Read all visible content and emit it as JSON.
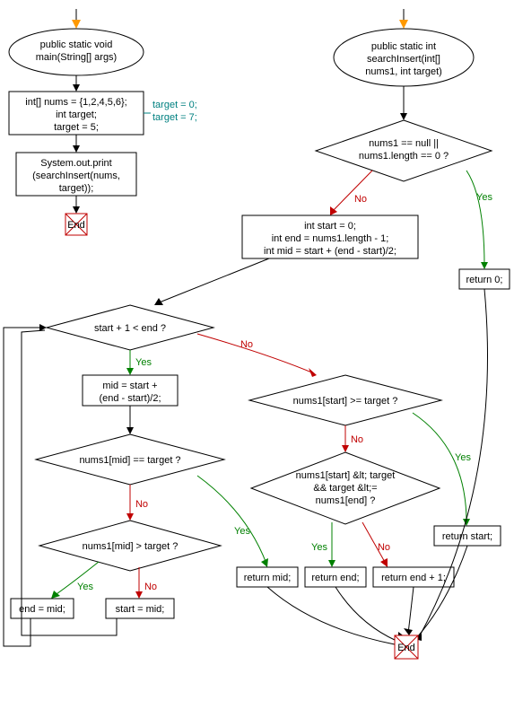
{
  "chart_data": {
    "type": "flowchart",
    "functions": [
      {
        "id": "main",
        "signature": [
          "public static void",
          "main(String[] args)"
        ],
        "body": [
          {
            "kind": "process",
            "lines": [
              "int[] nums = {1,2,4,5,6};",
              "int target;",
              "target = 5;"
            ],
            "side_comments": [
              "target = 0;",
              "target = 7;"
            ]
          },
          {
            "kind": "process",
            "lines": [
              "System.out.print",
              "(searchInsert(nums,",
              "target));"
            ]
          },
          {
            "kind": "end",
            "label": "End"
          }
        ]
      },
      {
        "id": "searchInsert",
        "signature": [
          "public static int",
          "searchInsert(int[]",
          "nums1, int target)"
        ],
        "body": [
          {
            "kind": "decision",
            "id": "d_null",
            "lines": [
              "nums1 == null ||",
              "nums1.length == 0 ?"
            ],
            "yes": "ret0",
            "no": "init"
          },
          {
            "kind": "process",
            "id": "ret0",
            "lines": [
              "return 0;"
            ]
          },
          {
            "kind": "process",
            "id": "init",
            "lines": [
              "int start = 0;",
              "int end = nums1.length - 1;",
              "int mid = start + (end - start)/2;"
            ]
          },
          {
            "kind": "decision",
            "id": "d_loop",
            "lines": [
              "start + 1 < end ?"
            ],
            "yes": "mid_calc",
            "no": "d_start_ge"
          },
          {
            "kind": "process",
            "id": "mid_calc",
            "lines": [
              "mid = start +",
              "(end - start)/2;"
            ]
          },
          {
            "kind": "decision",
            "id": "d_mid_eq",
            "lines": [
              "nums1[mid] == target ?"
            ],
            "yes": "ret_mid",
            "no": "d_mid_gt"
          },
          {
            "kind": "decision",
            "id": "d_mid_gt",
            "lines": [
              "nums1[mid] > target ?"
            ],
            "yes": "end_mid",
            "no": "start_mid"
          },
          {
            "kind": "process",
            "id": "end_mid",
            "lines": [
              "end = mid;"
            ]
          },
          {
            "kind": "process",
            "id": "start_mid",
            "lines": [
              "start = mid;"
            ]
          },
          {
            "kind": "decision",
            "id": "d_start_ge",
            "lines": [
              "nums1[start] >= target ?"
            ],
            "yes": "ret_start",
            "no": "d_between"
          },
          {
            "kind": "decision",
            "id": "d_between",
            "lines": [
              "nums1[start] &lt; target",
              "&& target &lt;=",
              "nums1[end] ?"
            ],
            "yes": "ret_end",
            "no": "ret_end1"
          },
          {
            "kind": "process",
            "id": "ret_mid",
            "lines": [
              "return mid;"
            ]
          },
          {
            "kind": "process",
            "id": "ret_end",
            "lines": [
              "return end;"
            ]
          },
          {
            "kind": "process",
            "id": "ret_end1",
            "lines": [
              "return end + 1;"
            ]
          },
          {
            "kind": "process",
            "id": "ret_start",
            "lines": [
              "return start;"
            ]
          },
          {
            "kind": "end",
            "label": "End"
          }
        ]
      }
    ],
    "edge_labels": {
      "yes": "Yes",
      "no": "No"
    },
    "end_label": "End"
  }
}
